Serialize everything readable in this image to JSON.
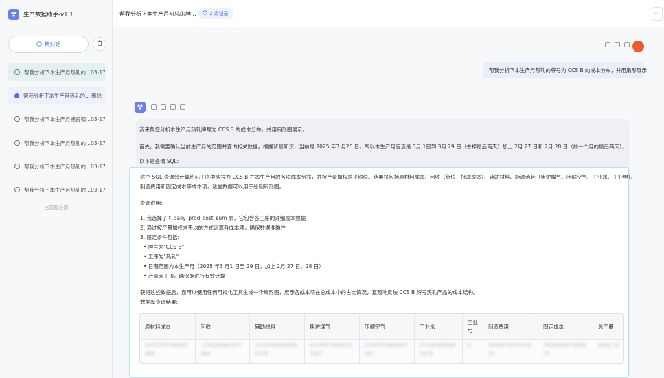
{
  "app": {
    "title": "生产数据助手-v1.1",
    "brand_color": "#6a7ff0"
  },
  "sidebar": {
    "new_chat_label": "新对话",
    "items": [
      {
        "label": "帮我分析下本生产月热轧的...",
        "time": "03-17",
        "state": "active"
      },
      {
        "label": "帮我分析下本生产月热轧的...",
        "action": "删除",
        "state": "selected"
      },
      {
        "label": "帮我分析下本生产月搪瓷钢...",
        "time": "03-17"
      },
      {
        "label": "帮我分析下本生产月热轧的...",
        "time": "03-17"
      },
      {
        "label": "帮我分析下本生产月热轧的...",
        "time": "03-17"
      },
      {
        "label": "帮我分析下本生产月热轧的...",
        "time": "03-17"
      }
    ],
    "loaded_all": "已加载全部"
  },
  "topbar": {
    "title": "帮我分析下本生产月热轧的牌...",
    "records": "2 条记录",
    "more": "···"
  },
  "user_message": "帮我分析下本生产月热轧的牌号为 CCS B 的成本分布，并用扇形展示",
  "answer": {
    "intro": "我来帮您分析本生产月热轧牌号为 CCS B 的成本分布，并用扇形图展示。",
    "step1": "首先，我需要确认当前生产月的范围并查询相关数据。根据背景知识，当前是 2025 年3 月25 日，所以本生产月应该是 3月 1日到 3月 29 日（去掉最后两天）加上 2月 27 日和 2月 28 日（前一个月的最后两天）。",
    "sql_intro": "以下是查询 SQL:",
    "sql_desc_1": "这个 SQL 查询会计算热轧工序中牌号为 CCS B 在本生产月的各项成本分布，并按产量加权求平均值。结果将包括原材料成本、回收（负值，抵减成本）、辅助材料、能源消耗（焦炉煤气、压缩空气、工业水、工业电）、",
    "sql_desc_2": "制造费用和固定成本等成本项，这些数据可以用于绘制扇形图。",
    "explain_title": "查询说明:",
    "points": [
      "1. 我选择了 t_daily_prod_cost_sum 表，它包含各工序的详细成本数据",
      "2. 通过按产量加权求平均的方式计算各成本项，确保数据准确性",
      "3. 限定条件包括:"
    ],
    "conditions": [
      "牌号为\"CCS B\"",
      "工序为\"热轧\"",
      "日期范围为本生产月（2025 年3 月1 日至 29 日，加上 2月 27 日、28 日）",
      "产量大于 0，确保能进行有效计算"
    ],
    "conclusion": "获得这些数据后，您可以使用任何可视化工具生成一个扇形图，展示各成本项在总成本中的占比情况，直观地反映 CCS B 牌号热轧产品的成本结构。",
    "result_title": "数据库查询结果:"
  },
  "table": {
    "headers": [
      "原材料成本",
      "回收",
      "辅助材料",
      "焦炉煤气",
      "压缩空气",
      "工业水",
      "工业电",
      "制造费用",
      "固定成本",
      "总产量"
    ],
    "row": [
      "2475745746847468",
      "-124548461457464",
      "13157460948456378",
      "42149576464151567",
      "2249757604847567",
      "571464684681578",
      "0",
      "445497454141455",
      "781456647485875",
      "4426.25"
    ]
  }
}
